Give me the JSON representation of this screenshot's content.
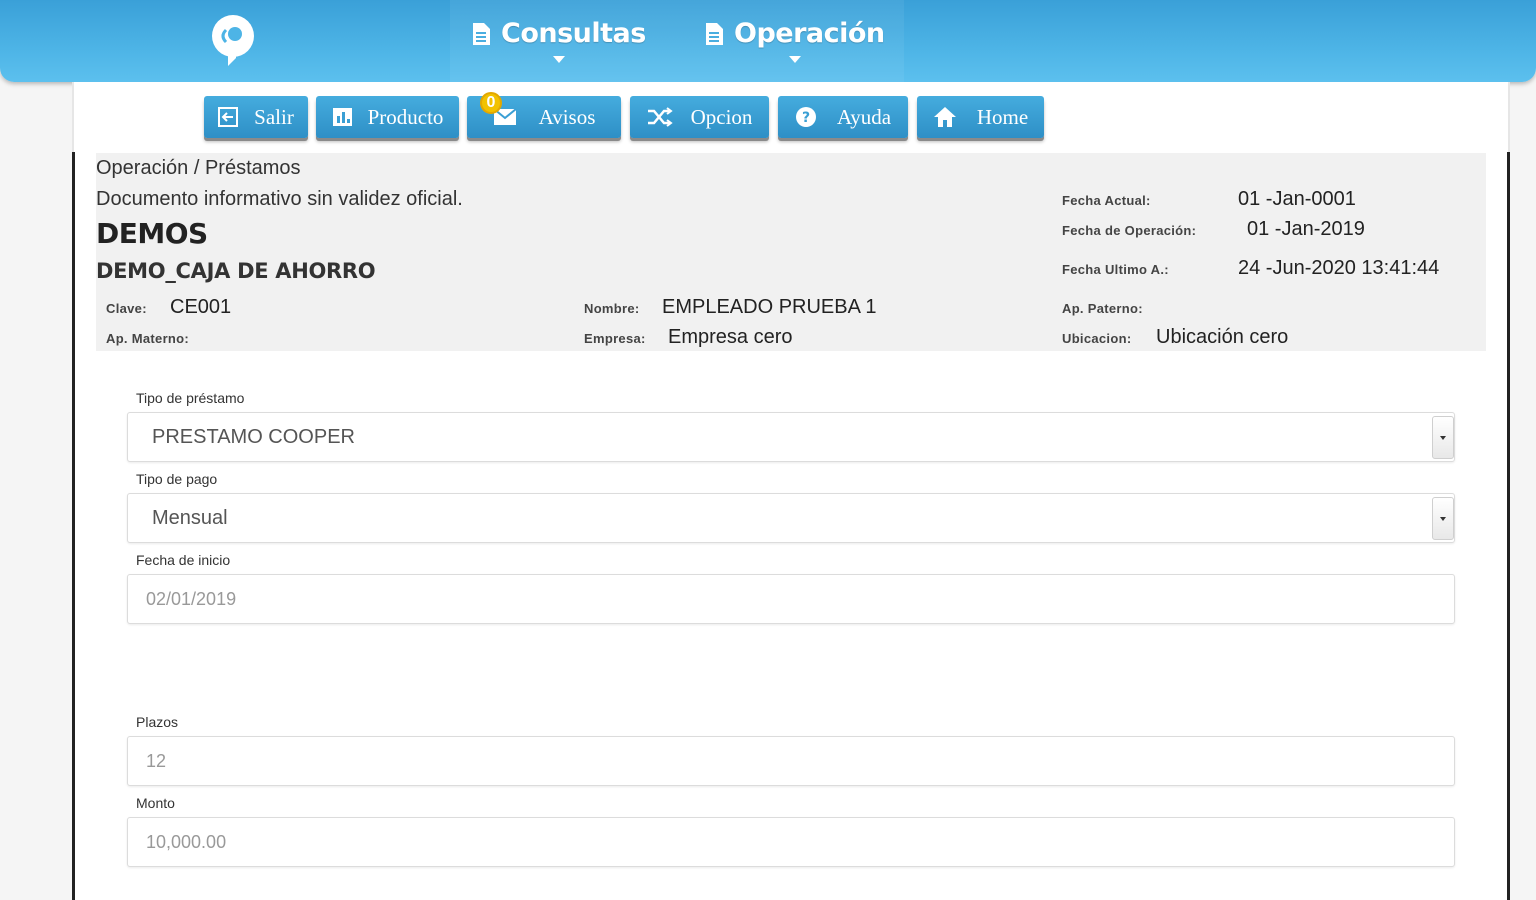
{
  "nav": {
    "consultas": "Consultas",
    "operacion": "Operación"
  },
  "toolbar": {
    "salir": "Salir",
    "producto": "Producto",
    "avisos": "Avisos",
    "avisos_badge": "0",
    "opcion": "Opcion",
    "ayuda": "Ayuda",
    "home": "Home"
  },
  "info": {
    "breadcrumb": "Operación / Préstamos",
    "disclaimer": "Documento informativo sin validez oficial.",
    "company": "DEMOS",
    "product": "DEMO_CAJA DE AHORRO",
    "fecha_actual_label": "Fecha Actual:",
    "fecha_actual": "01 -Jan-0001",
    "fecha_operacion_label": "Fecha de Operación:",
    "fecha_operacion": "01 -Jan-2019",
    "fecha_ultimo_label": "Fecha Ultimo A.:",
    "fecha_ultimo": "24 -Jun-2020 13:41:44",
    "clave_label": "Clave:",
    "clave": "CE001",
    "nombre_label": "Nombre:",
    "nombre": "EMPLEADO PRUEBA 1",
    "ap_paterno_label": "Ap. Paterno:",
    "ap_paterno": "",
    "ap_materno_label": "Ap. Materno:",
    "ap_materno": "",
    "empresa_label": "Empresa:",
    "empresa": "Empresa cero",
    "ubicacion_label": "Ubicacion:",
    "ubicacion": "Ubicación cero"
  },
  "form": {
    "tipo_prestamo_label": "Tipo de préstamo",
    "tipo_prestamo": "PRESTAMO COOPER",
    "tipo_pago_label": "Tipo de pago",
    "tipo_pago": "Mensual",
    "fecha_inicio_label": "Fecha de inicio",
    "fecha_inicio": "02/01/2019",
    "plazos_label": "Plazos",
    "plazos": "12",
    "monto_label": "Monto",
    "monto": "10,000.00"
  },
  "colors": {
    "header": "#4db4e6",
    "button": "#3a9fd4",
    "badge": "#f2c200",
    "panel": "#f1f1f1"
  }
}
